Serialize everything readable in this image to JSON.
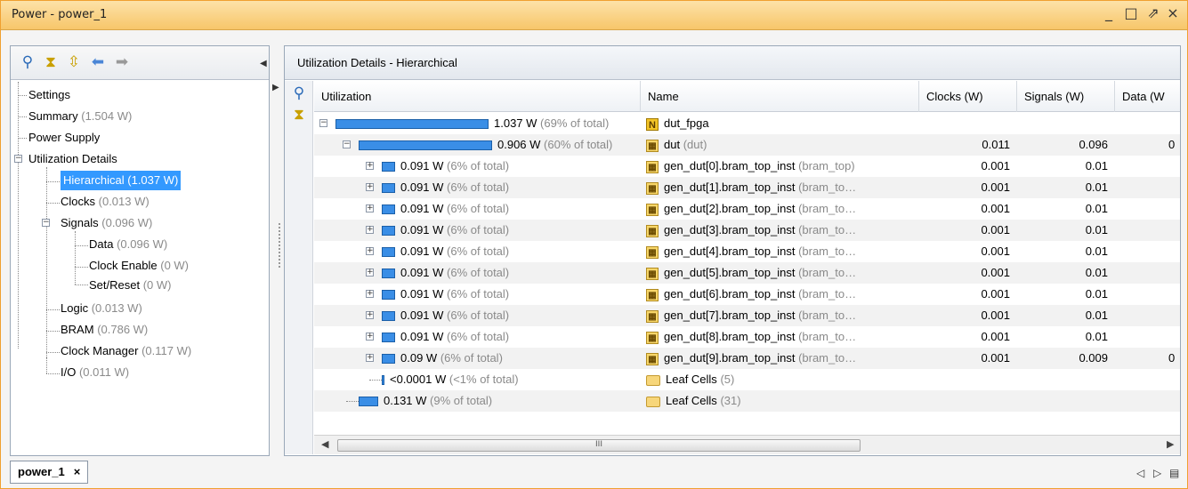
{
  "window": {
    "title": "Power - power_1",
    "controls": {
      "minimize": "_",
      "maximize": "□",
      "restore": "⇗",
      "close": "×"
    }
  },
  "left_toolbar": {
    "icons": [
      "search-icon",
      "collapse-all-icon",
      "expand-all-icon",
      "back-arrow-icon",
      "forward-arrow-icon"
    ]
  },
  "tree": {
    "settings": {
      "label": "Settings"
    },
    "summary": {
      "label": "Summary",
      "value": "(1.504 W)"
    },
    "power_supply": {
      "label": "Power Supply"
    },
    "utilization": {
      "label": "Utilization Details"
    },
    "hierarchical": {
      "label": "Hierarchical",
      "value": "(1.037 W)"
    },
    "clocks": {
      "label": "Clocks",
      "value": "(0.013 W)"
    },
    "signals": {
      "label": "Signals",
      "value": "(0.096 W)"
    },
    "data": {
      "label": "Data",
      "value": "(0.096 W)"
    },
    "clock_enable": {
      "label": "Clock Enable",
      "value": "(0 W)"
    },
    "set_reset": {
      "label": "Set/Reset",
      "value": "(0 W)"
    },
    "logic": {
      "label": "Logic",
      "value": "(0.013 W)"
    },
    "bram": {
      "label": "BRAM",
      "value": "(0.786 W)"
    },
    "clock_manager": {
      "label": "Clock Manager",
      "value": "(0.117 W)"
    },
    "io": {
      "label": "I/O",
      "value": "(0.011 W)"
    }
  },
  "right_panel": {
    "title": "Utilization Details - Hierarchical",
    "columns": [
      "Utilization",
      "Name",
      "Clocks (W)",
      "Signals (W)",
      "Data (W"
    ],
    "rows": [
      {
        "value": "1.037 W",
        "pct": "(69% of total)",
        "level": 0.69,
        "name": "dut_fpga",
        "sub": "",
        "icon": "n",
        "clocks": "",
        "signals": "",
        "data": ""
      },
      {
        "value": "0.906 W",
        "pct": "(60% of total)",
        "level": 0.6,
        "name": "dut",
        "sub": "(dut)",
        "icon": "r",
        "clocks": "0.011",
        "signals": "0.096",
        "data": "0"
      },
      {
        "value": "0.091 W",
        "pct": "(6% of total)",
        "level": 0.06,
        "name": "gen_dut[0].bram_top_inst",
        "sub": "(bram_top)",
        "icon": "r",
        "clocks": "0.001",
        "signals": "0.01",
        "data": ""
      },
      {
        "value": "0.091 W",
        "pct": "(6% of total)",
        "level": 0.06,
        "name": "gen_dut[1].bram_top_inst",
        "sub": "(bram_to…",
        "icon": "r",
        "clocks": "0.001",
        "signals": "0.01",
        "data": ""
      },
      {
        "value": "0.091 W",
        "pct": "(6% of total)",
        "level": 0.06,
        "name": "gen_dut[2].bram_top_inst",
        "sub": "(bram_to…",
        "icon": "r",
        "clocks": "0.001",
        "signals": "0.01",
        "data": ""
      },
      {
        "value": "0.091 W",
        "pct": "(6% of total)",
        "level": 0.06,
        "name": "gen_dut[3].bram_top_inst",
        "sub": "(bram_to…",
        "icon": "r",
        "clocks": "0.001",
        "signals": "0.01",
        "data": ""
      },
      {
        "value": "0.091 W",
        "pct": "(6% of total)",
        "level": 0.06,
        "name": "gen_dut[4].bram_top_inst",
        "sub": "(bram_to…",
        "icon": "r",
        "clocks": "0.001",
        "signals": "0.01",
        "data": ""
      },
      {
        "value": "0.091 W",
        "pct": "(6% of total)",
        "level": 0.06,
        "name": "gen_dut[5].bram_top_inst",
        "sub": "(bram_to…",
        "icon": "r",
        "clocks": "0.001",
        "signals": "0.01",
        "data": ""
      },
      {
        "value": "0.091 W",
        "pct": "(6% of total)",
        "level": 0.06,
        "name": "gen_dut[6].bram_top_inst",
        "sub": "(bram_to…",
        "icon": "r",
        "clocks": "0.001",
        "signals": "0.01",
        "data": ""
      },
      {
        "value": "0.091 W",
        "pct": "(6% of total)",
        "level": 0.06,
        "name": "gen_dut[7].bram_top_inst",
        "sub": "(bram_to…",
        "icon": "r",
        "clocks": "0.001",
        "signals": "0.01",
        "data": ""
      },
      {
        "value": "0.091 W",
        "pct": "(6% of total)",
        "level": 0.06,
        "name": "gen_dut[8].bram_top_inst",
        "sub": "(bram_to…",
        "icon": "r",
        "clocks": "0.001",
        "signals": "0.01",
        "data": ""
      },
      {
        "value": "0.09 W",
        "pct": "(6% of total)",
        "level": 0.06,
        "name": "gen_dut[9].bram_top_inst",
        "sub": "(bram_to…",
        "icon": "r",
        "clocks": "0.001",
        "signals": "0.009",
        "data": "0"
      },
      {
        "value": "<0.0001 W",
        "pct": "(<1% of total)",
        "level": 0.0,
        "name": "Leaf Cells",
        "sub": "(5)",
        "icon": "folder",
        "clocks": "",
        "signals": "",
        "data": ""
      },
      {
        "value": "0.131 W",
        "pct": "(9% of total)",
        "level": 0.09,
        "name": "Leaf Cells",
        "sub": "(31)",
        "icon": "folder",
        "clocks": "",
        "signals": "",
        "data": ""
      }
    ],
    "scroll_thumb_label": "III"
  },
  "bottom": {
    "tab_label": "power_1",
    "tab_close": "×",
    "controls": [
      "◁",
      "▷",
      "▤"
    ]
  }
}
